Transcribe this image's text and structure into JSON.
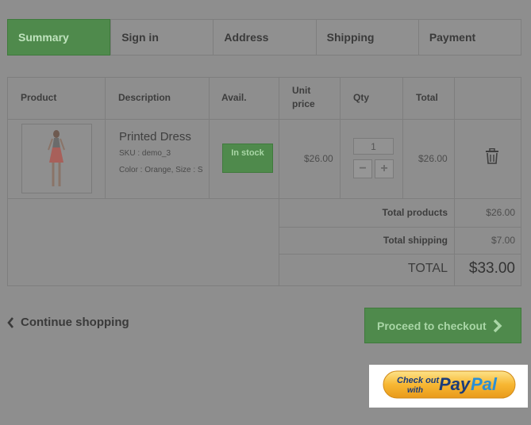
{
  "steps": [
    {
      "label": "Summary",
      "active": true
    },
    {
      "label": "Sign in",
      "active": false
    },
    {
      "label": "Address",
      "active": false
    },
    {
      "label": "Shipping",
      "active": false
    },
    {
      "label": "Payment",
      "active": false
    }
  ],
  "table": {
    "headers": {
      "product": "Product",
      "description": "Description",
      "avail": "Avail.",
      "unit_price_1": "Unit",
      "unit_price_2": "price",
      "qty": "Qty",
      "total": "Total"
    }
  },
  "item": {
    "name": "Printed Dress",
    "sku": "SKU : demo_3",
    "attributes": "Color : Orange, Size : S",
    "availability": "In stock",
    "unit_price": "$26.00",
    "quantity": "1",
    "total": "$26.00",
    "qty_minus": "−",
    "qty_plus": "+"
  },
  "summary": {
    "total_products_label": "Total products",
    "total_products_value": "$26.00",
    "total_shipping_label": "Total shipping",
    "total_shipping_value": "$7.00",
    "total_label": "TOTAL",
    "total_value": "$33.00"
  },
  "actions": {
    "continue_label": "Continue shopping",
    "checkout_label": "Proceed to checkout"
  },
  "paypal": {
    "line1": "Check out",
    "line2": "with",
    "brand_pay": "Pay",
    "brand_pal": "Pal"
  },
  "colors": {
    "overlay": "#8e8e8e",
    "accent_green": "#4f8a4c",
    "paypal_yellow": "#f7b733",
    "paypal_blue": "#1b3c7a"
  }
}
